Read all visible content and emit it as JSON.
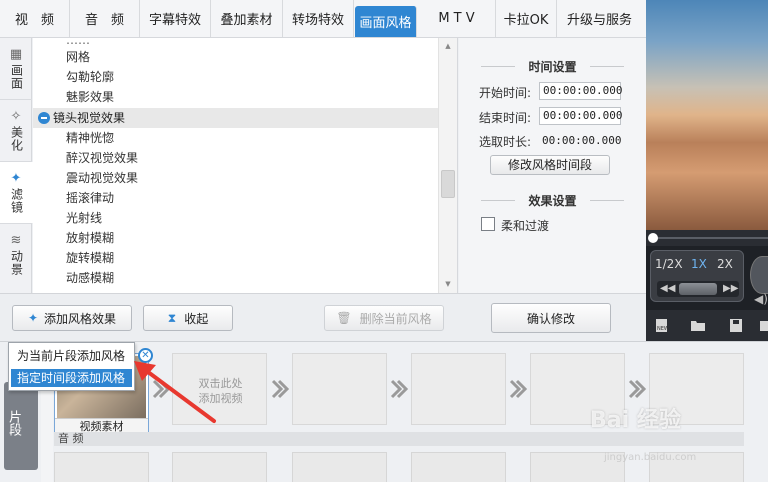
{
  "tabs": [
    {
      "label": "视　频"
    },
    {
      "label": "音　频"
    },
    {
      "label": "字幕特效"
    },
    {
      "label": "叠加素材"
    },
    {
      "label": "转场特效"
    },
    {
      "label": "画面风格",
      "active": true
    },
    {
      "label": "M T V"
    },
    {
      "label": "卡拉OK"
    },
    {
      "label": "升级与服务"
    }
  ],
  "vtabs": [
    {
      "label": "画面",
      "icon": "film-strip-icon"
    },
    {
      "label": "美化",
      "icon": "magic-wand-icon"
    },
    {
      "label": "滤镜",
      "icon": "sparkle-wand-icon",
      "active": true
    },
    {
      "label": "动景",
      "icon": "wave-icon"
    }
  ],
  "effects": {
    "items_top": [
      "网格",
      "勾勒轮廓",
      "魅影效果"
    ],
    "group": "镜头视觉效果",
    "items_group": [
      "精神恍惚",
      "醉汉视觉效果",
      "震动视觉效果",
      "摇滚律动",
      "光射线",
      "放射模糊",
      "旋转模糊",
      "动感模糊"
    ],
    "partial_top_item": "……"
  },
  "settings": {
    "time_header": "时间设置",
    "start_label": "开始时间:",
    "start_value": "00:00:00.000",
    "end_label": "结束时间:",
    "end_value": "00:00:00.000",
    "duration_label": "选取时长:",
    "duration_value": "00:00:00.000",
    "modify_btn": "修改风格时间段",
    "effect_header": "效果设置",
    "fade_label": "柔和过渡",
    "confirm_btn": "确认修改"
  },
  "toolbar": {
    "add_style": "添加风格效果",
    "collapse": "收起",
    "delete_style": "删除当前风格"
  },
  "popup": {
    "item1": "为当前片段添加风格",
    "item2": "指定时间段添加风格"
  },
  "timeline": {
    "side_tab": "片段",
    "video_caption": "视频素材",
    "add_hint_line1": "双击此处",
    "add_hint_line2": "添加视频",
    "audio_label": "音 频"
  },
  "player": {
    "speeds": [
      "1/2X",
      "1X",
      "2X"
    ],
    "active_speed": "1X",
    "icons": [
      "new-file-icon",
      "folder-open-icon",
      "save-icon",
      "export-icon"
    ]
  },
  "watermark": {
    "text": "Bai 经验",
    "url": "jingyan.baidu.com"
  },
  "colors": {
    "accent": "#2f86d2",
    "arrow": "#e8382f"
  }
}
